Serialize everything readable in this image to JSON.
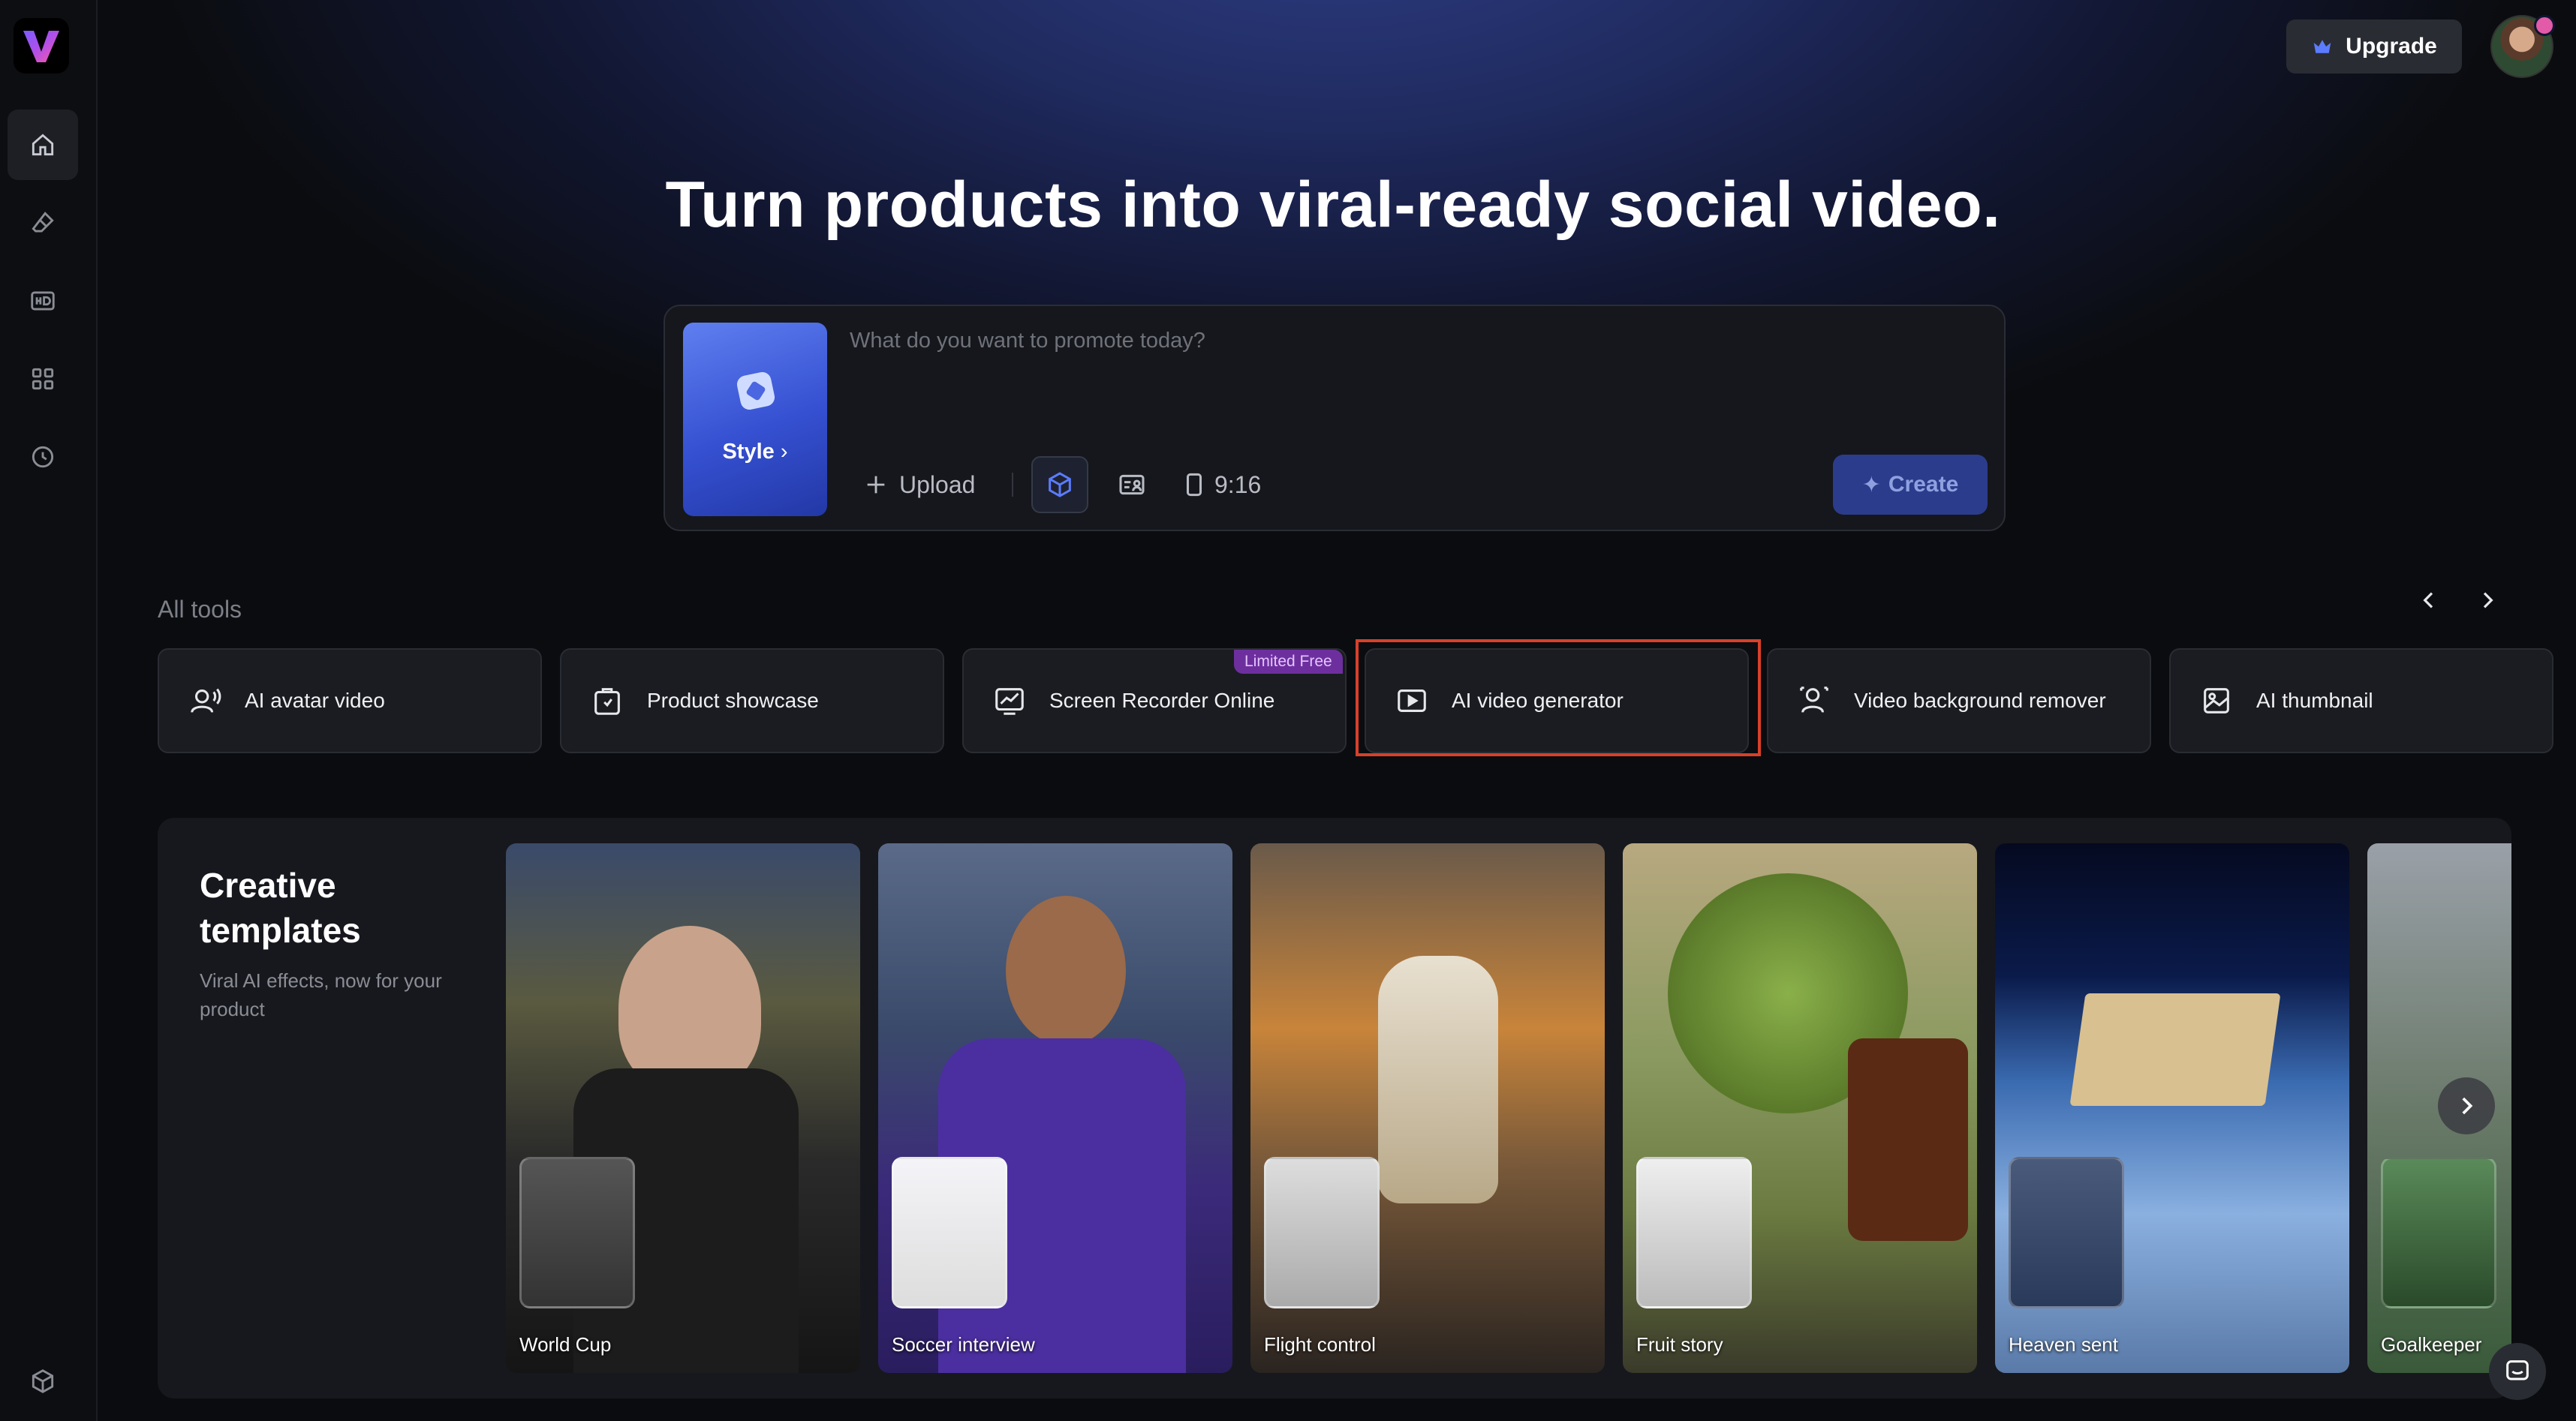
{
  "colors": {
    "accent": "#3550d1",
    "highlight": "#d8402a",
    "badge": "#6d2f9e"
  },
  "header": {
    "upgrade_label": "Upgrade"
  },
  "sidebar": {
    "items": [
      {
        "icon": "home-icon",
        "active": true
      },
      {
        "icon": "eraser-icon"
      },
      {
        "icon": "hd-icon"
      },
      {
        "icon": "apps-grid-icon"
      },
      {
        "icon": "history-clock-icon"
      },
      {
        "icon": "box-icon"
      }
    ]
  },
  "hero": {
    "title": "Turn products into viral-ready social video."
  },
  "prompt": {
    "placeholder": "What do you want to promote today?",
    "style_label": "Style",
    "upload_label": "Upload",
    "ratio_label": "9:16",
    "create_label": "Create"
  },
  "tools": {
    "section_label": "All tools",
    "items": [
      {
        "label": "AI avatar video",
        "icon": "avatar-voice-icon"
      },
      {
        "label": "Product showcase",
        "icon": "product-bag-icon"
      },
      {
        "label": "Screen Recorder Online",
        "icon": "trend-chart-icon",
        "badge": "Limited Free"
      },
      {
        "label": "AI video generator",
        "icon": "play-video-icon",
        "highlighted": true
      },
      {
        "label": "Video background remover",
        "icon": "person-remove-bg-icon"
      },
      {
        "label": "AI thumbnail",
        "icon": "image-thumbnail-icon"
      }
    ]
  },
  "templates": {
    "title": "Creative templates",
    "subtitle": "Viral AI effects, now for your product",
    "items": [
      {
        "label": "World Cup"
      },
      {
        "label": "Soccer interview"
      },
      {
        "label": "Flight control"
      },
      {
        "label": "Fruit story"
      },
      {
        "label": "Heaven sent"
      },
      {
        "label": "Goalkeeper"
      }
    ]
  }
}
